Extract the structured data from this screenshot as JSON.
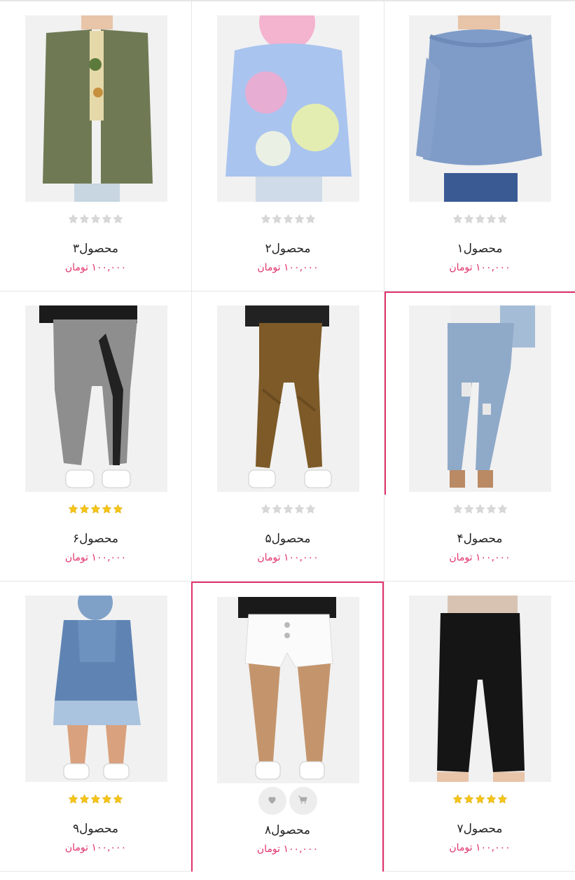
{
  "colors": {
    "accent": "#e0336a",
    "border": "#e6e6e6",
    "star_filled": "#f5c518",
    "star_empty": "#d8d8d8"
  },
  "products": [
    {
      "title": "محصول۱",
      "price": "۱۰۰,۰۰۰ تومان",
      "rating": 0,
      "image": "blue-off-shoulder-top",
      "state": "normal"
    },
    {
      "title": "محصول۲",
      "price": "۱۰۰,۰۰۰ تومان",
      "rating": 0,
      "image": "tie-dye-hoodie",
      "state": "normal"
    },
    {
      "title": "محصول۳",
      "price": "۱۰۰,۰۰۰ تومان",
      "rating": 0,
      "image": "olive-utility-jacket",
      "state": "normal"
    },
    {
      "title": "محصول۴",
      "price": "۱۰۰,۰۰۰ تومان",
      "rating": 0,
      "image": "ripped-skinny-jeans",
      "state": "partial-hover"
    },
    {
      "title": "محصول۵",
      "price": "۱۰۰,۰۰۰ تومان",
      "rating": 0,
      "image": "brown-moto-leggings",
      "state": "normal"
    },
    {
      "title": "محصول۶",
      "price": "۱۰۰,۰۰۰ تومان",
      "rating": 5,
      "image": "grey-sport-leggings",
      "state": "normal"
    },
    {
      "title": "محصول۷",
      "price": "۱۰۰,۰۰۰ تومان",
      "rating": 5,
      "image": "black-wide-pants",
      "state": "normal"
    },
    {
      "title": "محصول۸",
      "price": "۱۰۰,۰۰۰ تومان",
      "rating": 0,
      "image": "white-denim-shorts",
      "state": "hover",
      "actions": [
        {
          "icon": "heart-icon"
        },
        {
          "icon": "cart-icon"
        }
      ]
    },
    {
      "title": "محصول۹",
      "price": "۱۰۰,۰۰۰ تومان",
      "rating": 5,
      "image": "denim-overall-shorts",
      "state": "normal"
    }
  ]
}
